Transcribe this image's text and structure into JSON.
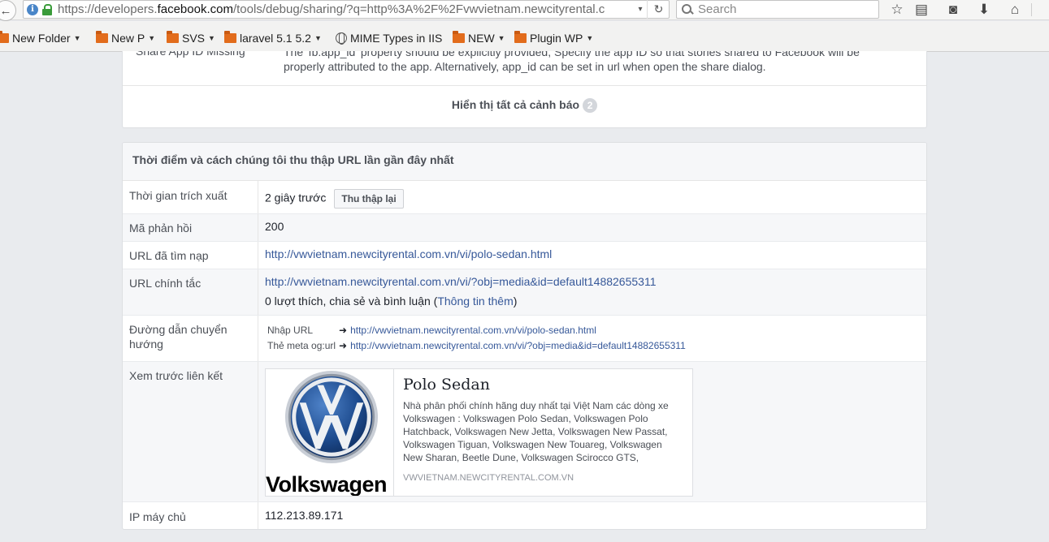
{
  "browser": {
    "url_prefix": "https://developers.",
    "url_domain": "facebook.com",
    "url_suffix": "/tools/debug/sharing/?q=http%3A%2F%2Fvwvietnam.newcityrental.c",
    "search_placeholder": "Search",
    "bookmarks": [
      {
        "label": "New Folder",
        "icon": "folder-icon"
      },
      {
        "label": "New P",
        "icon": "folder-icon"
      },
      {
        "label": "SVS",
        "icon": "folder-icon"
      },
      {
        "label": "laravel 5.1 5.2",
        "icon": "folder-icon"
      },
      {
        "label": "MIME Types in IIS",
        "icon": "globe-icon"
      },
      {
        "label": "NEW",
        "icon": "folder-icon"
      },
      {
        "label": "Plugin WP",
        "icon": "folder-icon"
      }
    ]
  },
  "warning": {
    "title": "Share App ID Missing",
    "body": "The 'fb:app_id' property should be explicitly provided, Specify the app ID so that stories shared to Facebook will be properly attributed to the app. Alternatively, app_id can be set in url when open the share dialog.",
    "show_all": "Hiển thị tất cả cảnh báo",
    "count": "2"
  },
  "scrape": {
    "header": "Thời điểm và cách chúng tôi thu thập URL lần gần đây nhất",
    "time_label": "Thời gian trích xuất",
    "time_value": "2 giây trước",
    "rescrape_button": "Thu thập lại",
    "response_label": "Mã phản hồi",
    "response_value": "200",
    "fetched_label": "URL đã tìm nạp",
    "fetched_value": "http://vwvietnam.newcityrental.com.vn/vi/polo-sedan.html",
    "canonical_label": "URL chính tắc",
    "canonical_value": "http://vwvietnam.newcityrental.com.vn/vi/?obj=media&id=default14882655311",
    "engagement_prefix": "0 lượt thích, chia sẻ và bình luận (",
    "engagement_link": "Thông tin thêm",
    "engagement_suffix": ")",
    "redirect_label": "Đường dẫn chuyển hướng",
    "redirect_input_key": "Nhập URL",
    "redirect_input_value": "http://vwvietnam.newcityrental.com.vn/vi/polo-sedan.html",
    "redirect_og_key": "Thẻ meta og:url",
    "redirect_og_value": "http://vwvietnam.newcityrental.com.vn/vi/?obj=media&id=default14882655311",
    "preview_label": "Xem trước liên kết",
    "preview": {
      "image_word": "Volkswagen",
      "title": "Polo Sedan",
      "description": "Nhà phân phối chính hãng duy nhất tại Việt Nam các dòng xe Volkswagen : Volkswagen Polo Sedan, Volkswagen Polo Hatchback, Volkswagen New Jetta, Volkswagen New Passat, Volkswagen Tiguan, Volkswagen New Touareg, Volkswagen New Sharan, Beetle Dune, Volkswagen Scirocco GTS,",
      "domain": "VWVIETNAM.NEWCITYRENTAL.COM.VN"
    },
    "ip_label": "IP máy chủ",
    "ip_value": "112.213.89.171"
  },
  "colors": {
    "link": "#365899",
    "page_bg": "#e9ebee",
    "vw_blue": "#1e4c8f"
  }
}
